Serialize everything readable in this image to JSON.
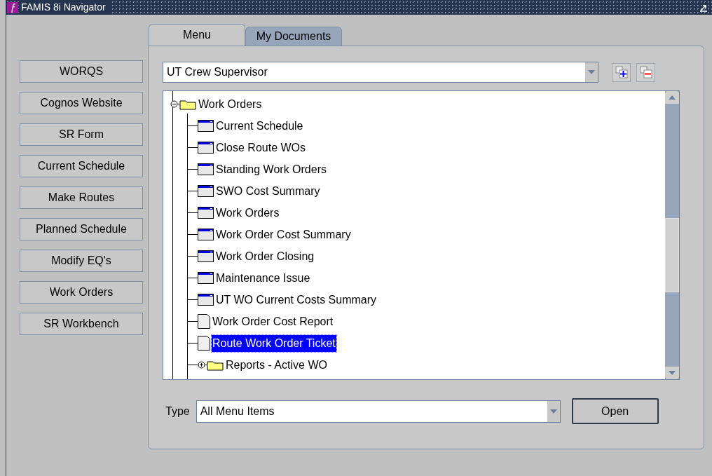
{
  "window": {
    "title": "FAMIS 8i Navigator"
  },
  "shortcuts": [
    "WORQS",
    "Cognos Website",
    "SR Form",
    "Current Schedule",
    "Make Routes",
    "Planned Schedule",
    "Modify EQ's",
    "Work Orders",
    "SR Workbench"
  ],
  "tabs": [
    {
      "label": "Menu",
      "selected": true
    },
    {
      "label": "My Documents",
      "selected": false
    }
  ],
  "responsibility": {
    "value": "UT Crew Supervisor"
  },
  "tree": [
    {
      "label": "Work Orders",
      "kind": "folder",
      "expanded": true,
      "selected": false,
      "children": [
        {
          "label": "Current Schedule",
          "kind": "form",
          "selected": false
        },
        {
          "label": "Close Route WOs",
          "kind": "form",
          "selected": false
        },
        {
          "label": "Standing Work Orders",
          "kind": "form",
          "selected": false
        },
        {
          "label": "SWO Cost Summary",
          "kind": "form",
          "selected": false
        },
        {
          "label": "Work Orders",
          "kind": "form",
          "selected": false
        },
        {
          "label": "Work Order Cost Summary",
          "kind": "form",
          "selected": false
        },
        {
          "label": "Work Order Closing",
          "kind": "form",
          "selected": false
        },
        {
          "label": "Maintenance Issue",
          "kind": "form",
          "selected": false
        },
        {
          "label": "UT WO Current Costs Summary",
          "kind": "form",
          "selected": false
        },
        {
          "label": "Work Order Cost Report",
          "kind": "report",
          "selected": false
        },
        {
          "label": "Route Work Order Ticket",
          "kind": "report",
          "selected": true
        },
        {
          "label": "Reports - Active WO",
          "kind": "folder",
          "expanded": false,
          "selected": false
        }
      ]
    }
  ],
  "type_filter": {
    "label": "Type",
    "value": "All Menu Items"
  },
  "open_button": {
    "label": "Open"
  }
}
